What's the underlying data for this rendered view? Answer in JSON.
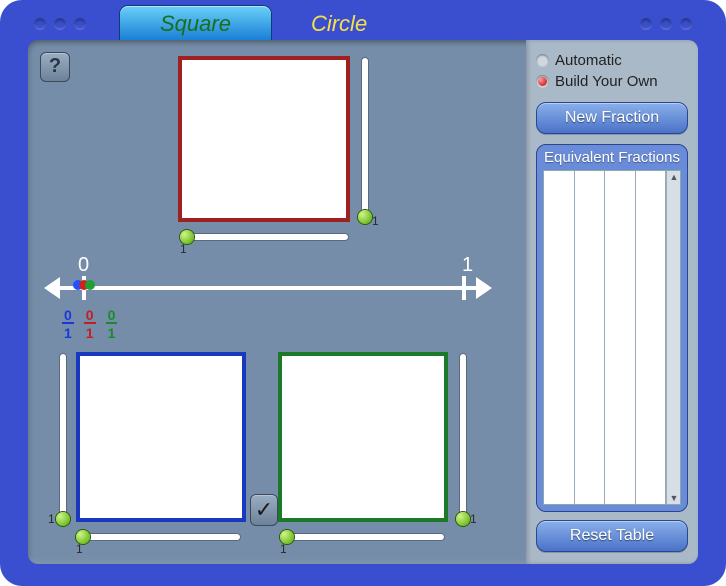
{
  "tabs": {
    "square": "Square",
    "circle": "Circle",
    "active": "square"
  },
  "help_label": "?",
  "check_label": "✓",
  "numline": {
    "zero": "0",
    "one": "1"
  },
  "fractions": {
    "blue": {
      "num": "0",
      "den": "1"
    },
    "red": {
      "num": "0",
      "den": "1"
    },
    "green": {
      "num": "0",
      "den": "1"
    }
  },
  "sliders": {
    "top_v": {
      "end_label": "1"
    },
    "top_h": {
      "end_label": "1"
    },
    "bl_v": {
      "end_label": "1"
    },
    "bl_h": {
      "end_label": "1"
    },
    "br_v": {
      "end_label": "1"
    },
    "br_h": {
      "end_label": "1"
    }
  },
  "side": {
    "mode_auto": "Automatic",
    "mode_build": "Build Your Own",
    "selected_mode": "build",
    "new_fraction": "New Fraction",
    "table_title": "Equivalent Fractions",
    "reset_table": "Reset Table"
  }
}
